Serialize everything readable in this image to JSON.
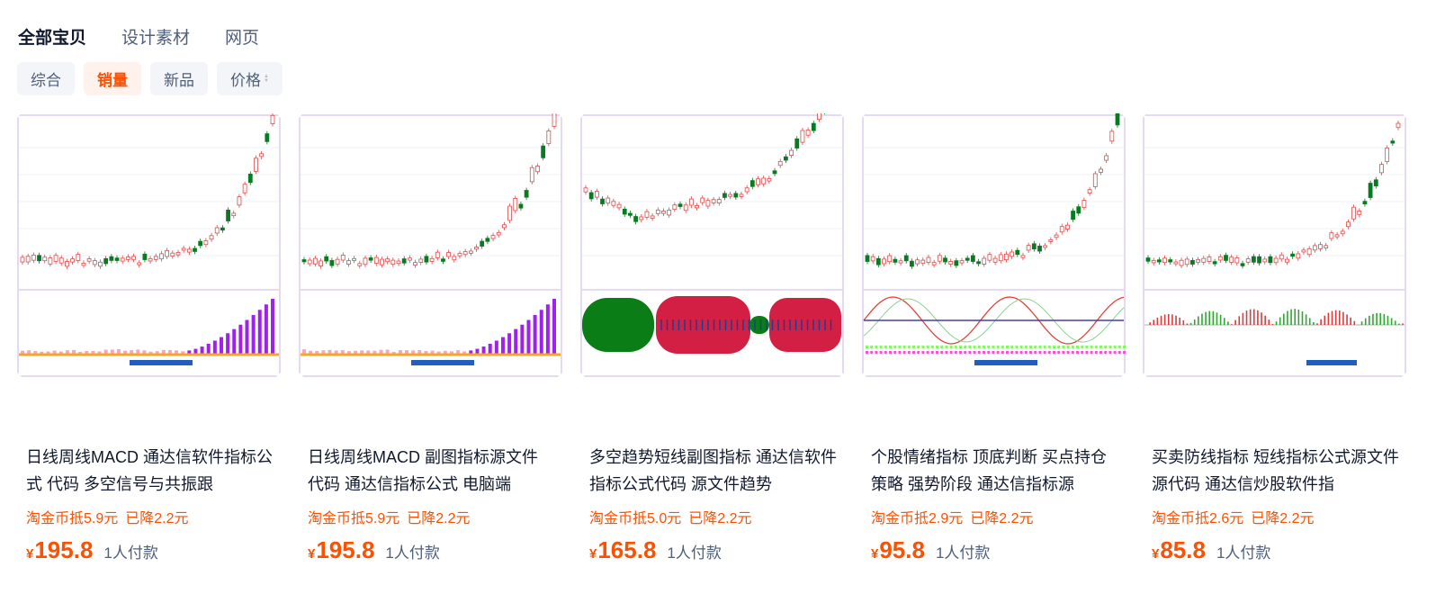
{
  "category_tabs": [
    {
      "label": "全部宝贝",
      "active": true
    },
    {
      "label": "设计素材",
      "active": false
    },
    {
      "label": "网页",
      "active": false
    }
  ],
  "sort_options": [
    {
      "label": "综合",
      "active": false
    },
    {
      "label": "销量",
      "active": true
    },
    {
      "label": "新品",
      "active": false
    },
    {
      "label": "价格",
      "active": false,
      "has_sort_arrows": true
    }
  ],
  "currency_symbol": "¥",
  "products": [
    {
      "title": "日线周线MACD 通达信软件指标公式 代码 多空信号与共振跟",
      "discount": "淘金币抵5.9元",
      "reduced": "已降2.2元",
      "price": "195.8",
      "sales": "1人付款",
      "thumb_style": "macd-purple-bars"
    },
    {
      "title": "日线周线MACD 副图指标源文件 代码 通达信指标公式 电脑端",
      "discount": "淘金币抵5.9元",
      "reduced": "已降2.2元",
      "price": "195.8",
      "sales": "1人付款",
      "thumb_style": "macd-purple-bars"
    },
    {
      "title": "多空趋势短线副图指标 通达信软件指标公式代码 源文件趋势",
      "discount": "淘金币抵5.0元",
      "reduced": "已降2.2元",
      "price": "165.8",
      "sales": "1人付款",
      "thumb_style": "trend-red-green-bands"
    },
    {
      "title": "个股情绪指标 顶底判断 买点持仓策略 强势阶段 通达信指标源",
      "discount": "淘金币抵2.9元",
      "reduced": "已降2.2元",
      "price": "95.8",
      "sales": "1人付款",
      "thumb_style": "sentiment-oscillator"
    },
    {
      "title": "买卖防线指标 短线指标公式源文件源代码 通达信炒股软件指",
      "discount": "淘金币抵2.6元",
      "reduced": "已降2.2元",
      "price": "85.8",
      "sales": "1人付款",
      "thumb_style": "macd-red-green-histogram"
    }
  ],
  "colors": {
    "accent": "#ff5000",
    "accent_bg": "#fff1eb",
    "text_primary": "#11192d",
    "text_secondary": "#50607a",
    "chip_bg": "#f3f5f8",
    "candle_up": "#e24a4a",
    "candle_down": "#0a7a22",
    "macd_purple": "#a020f0",
    "band_red": "#d41f45",
    "band_green": "#0b7d17"
  }
}
